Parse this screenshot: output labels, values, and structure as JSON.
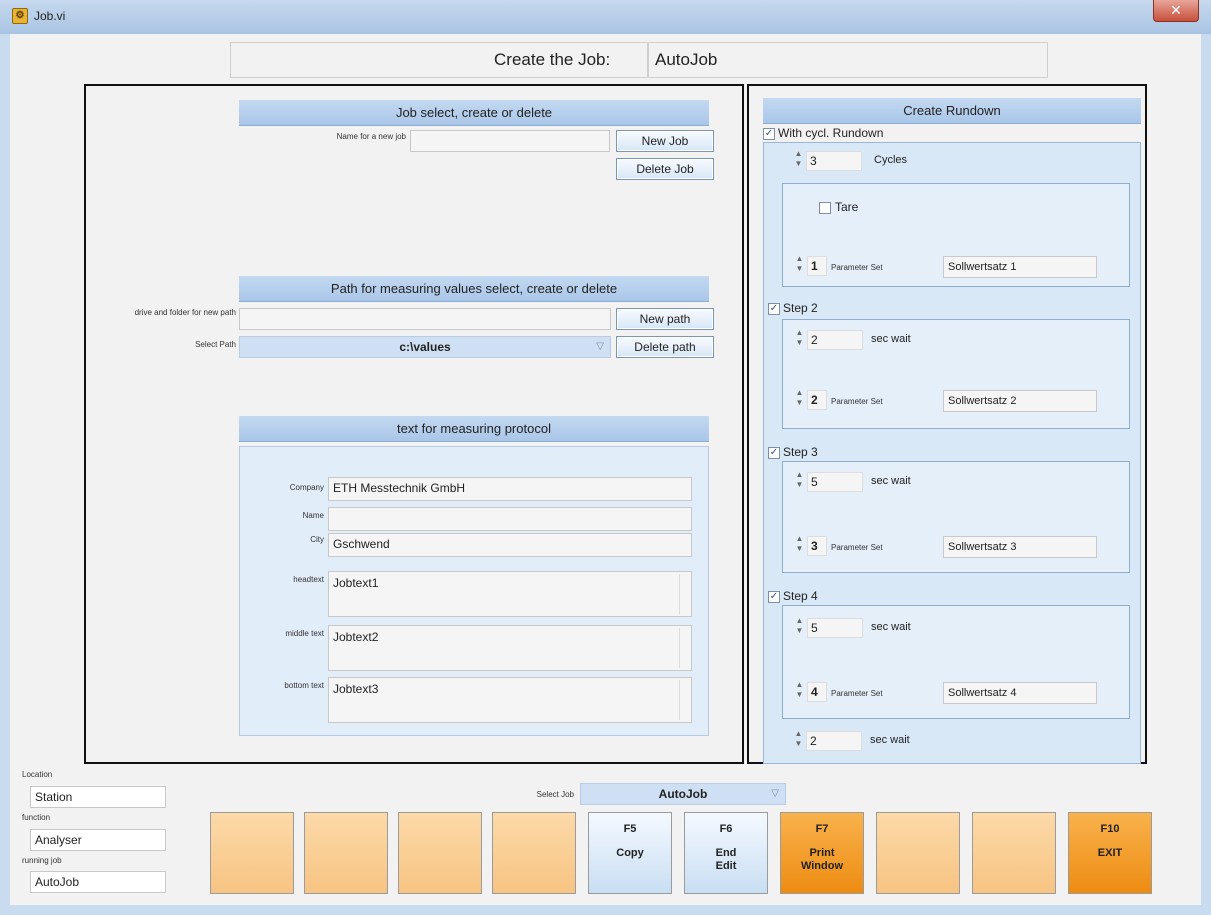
{
  "window": {
    "title": "Job.vi",
    "close": "✕"
  },
  "header": {
    "label": "Create the Job:",
    "value": "AutoJob"
  },
  "job_section": {
    "title": "Job select, create or delete",
    "name_label": "Name for a new job",
    "name_value": "",
    "new_button": "New Job",
    "delete_button": "Delete Job"
  },
  "path_section": {
    "title": "Path for measuring values select, create or delete",
    "drive_label": "drive and folder for new path",
    "drive_value": "",
    "select_label": "Select Path",
    "select_value": "c:\\values",
    "new_button": "New path",
    "delete_button": "Delete path"
  },
  "protocol_section": {
    "title": "text for measuring protocol",
    "company_label": "Company",
    "company_value": "ETH Messtechnik GmbH",
    "name_label": "Name",
    "name_value": "",
    "city_label": "City",
    "city_value": "Gschwend",
    "headtext_label": "headtext",
    "headtext_value": "Jobtext1",
    "middle_label": "middle text",
    "middle_value": "Jobtext2",
    "bottom_label": "bottom text",
    "bottom_value": "Jobtext3"
  },
  "rundown": {
    "title": "Create Rundown",
    "with_cycl_label": "With cycl. Rundown",
    "cycles_value": "3",
    "cycles_label": "Cycles",
    "tare_label": "Tare",
    "param_set_label": "Parameter Set",
    "sec_wait_label": "sec wait",
    "step1": {
      "param_num": "1",
      "param_name": "Sollwertsatz 1"
    },
    "step2": {
      "label": "Step 2",
      "wait": "2",
      "param_num": "2",
      "param_name": "Sollwertsatz 2"
    },
    "step3": {
      "label": "Step 3",
      "wait": "5",
      "param_num": "3",
      "param_name": "Sollwertsatz 3"
    },
    "step4": {
      "label": "Step 4",
      "wait": "5",
      "param_num": "4",
      "param_name": "Sollwertsatz 4"
    },
    "final_wait": "2"
  },
  "info": {
    "location_label": "Location",
    "location_value": "Station",
    "function_label": "function",
    "function_value": "Analyser",
    "running_label": "running job",
    "running_value": "AutoJob"
  },
  "select_job": {
    "label": "Select Job",
    "value": "AutoJob"
  },
  "fkeys": {
    "f5_key": "F5",
    "f5_label": "Copy",
    "f6_key": "F6",
    "f6_label": "End\nEdit",
    "f7_key": "F7",
    "f7_label": "Print\nWindow",
    "f10_key": "F10",
    "f10_label": "EXIT"
  },
  "colors": {
    "accent_orange": "#ed8c12",
    "panel_blue": "#d8e8f7",
    "header_blue": "#a9c6e8"
  },
  "icons": {
    "dropdown": "chevron-down-icon",
    "spinner": "spinner-icon",
    "checkbox": "checkmark-icon"
  }
}
